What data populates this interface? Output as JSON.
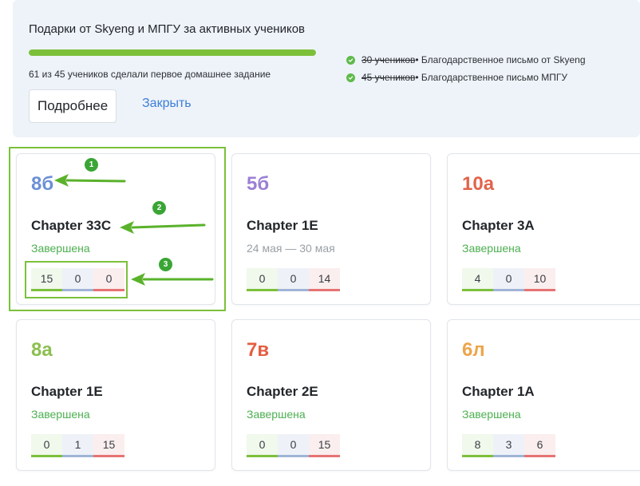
{
  "colors": {
    "accent_green": "#7cc03a",
    "link_blue": "#3d7fd8",
    "done_green": "#4caf50",
    "check_green": "#5fba4a"
  },
  "banner": {
    "title": "Подарки от Skyeng и МПГУ за активных учеников",
    "progress_fraction": 1.0,
    "progress_text": "61 из 45 учеников сделали первое домашнее задание",
    "rewards": [
      {
        "strike": "30 учеников",
        "text": " • Благодарственное письмо от Skyeng"
      },
      {
        "strike": "45 учеников",
        "text": " • Благодарственное письмо МПГУ"
      }
    ],
    "more_label": "Подробнее",
    "close_label": "Закрыть"
  },
  "cards": [
    {
      "class": "8б",
      "class_color": "#6b8fd6",
      "chapter": "Chapter 33C",
      "status": "Завершена",
      "status_color": "#4caf50",
      "stats": [
        15,
        0,
        0
      ]
    },
    {
      "class": "5б",
      "class_color": "#9b7fd4",
      "chapter": "Chapter 1E",
      "status": "24 мая — 30 мая",
      "status_color": "#9aa0a6",
      "stats": [
        0,
        0,
        14
      ]
    },
    {
      "class": "10а",
      "class_color": "#e2634a",
      "chapter": "Chapter 3A",
      "status": "Завершена",
      "status_color": "#4caf50",
      "stats": [
        4,
        0,
        10
      ]
    },
    {
      "class": "8а",
      "class_color": "#8cbf4f",
      "chapter": "Chapter 1E",
      "status": "Завершена",
      "status_color": "#4caf50",
      "stats": [
        0,
        1,
        15
      ]
    },
    {
      "class": "7в",
      "class_color": "#e55c3f",
      "chapter": "Chapter 2E",
      "status": "Завершена",
      "status_color": "#4caf50",
      "stats": [
        0,
        0,
        15
      ]
    },
    {
      "class": "6л",
      "class_color": "#eda54a",
      "chapter": "Chapter 1A",
      "status": "Завершена",
      "status_color": "#4caf50",
      "stats": [
        8,
        3,
        6
      ]
    }
  ],
  "stat_styles": [
    {
      "bg": "#f1f8ec",
      "bar": "#7cc03a"
    },
    {
      "bg": "#eef2f8",
      "bar": "#9fb4d6"
    },
    {
      "bg": "#fbeeee",
      "bar": "#e57373"
    }
  ],
  "annotations": [
    "1",
    "2",
    "3"
  ]
}
